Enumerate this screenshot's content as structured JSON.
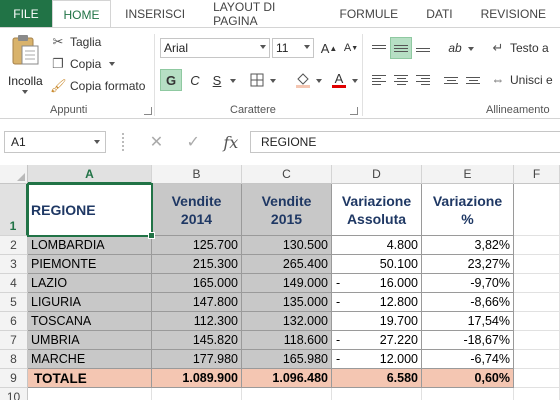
{
  "ribbon_tabs": [
    "FILE",
    "HOME",
    "INSERISCI",
    "LAYOUT DI PAGINA",
    "FORMULE",
    "DATI",
    "REVISIONE"
  ],
  "clipboard": {
    "paste_label": "Incolla",
    "cut_label": "Taglia",
    "copy_label": "Copia",
    "format_painter_label": "Copia formato",
    "group_label": "Appunti"
  },
  "font": {
    "font_name": "Arial",
    "font_size": "11",
    "bold_label": "G",
    "italic_label": "C",
    "underline_label": "S",
    "group_label": "Carattere"
  },
  "alignment": {
    "wrap_text_label": "Testo a",
    "merge_label": "Unisci e",
    "group_label": "Allineamento"
  },
  "formula_bar": {
    "name_box": "A1",
    "cancel_symbol": "✕",
    "enter_symbol": "✓",
    "fx_symbol": "fx",
    "content": "REGIONE"
  },
  "column_headers": [
    "A",
    "B",
    "C",
    "D",
    "E",
    "F"
  ],
  "row_headers": [
    "1",
    "2",
    "3",
    "4",
    "5",
    "6",
    "7",
    "8",
    "9",
    "10"
  ],
  "table": {
    "headers": {
      "a": "REGIONE",
      "b": "Vendite 2014",
      "c": "Vendite 2015",
      "d": "Variazione Assoluta",
      "e": "Variazione %"
    },
    "rows": [
      {
        "region": "LOMBARDIA",
        "v2014": "125.700",
        "v2015": "130.500",
        "neg": "",
        "abs": "4.800",
        "pct": "3,82%"
      },
      {
        "region": "PIEMONTE",
        "v2014": "215.300",
        "v2015": "265.400",
        "neg": "",
        "abs": "50.100",
        "pct": "23,27%"
      },
      {
        "region": "LAZIO",
        "v2014": "165.000",
        "v2015": "149.000",
        "neg": "-",
        "abs": "16.000",
        "pct": "-9,70%"
      },
      {
        "region": "LIGURIA",
        "v2014": "147.800",
        "v2015": "135.000",
        "neg": "-",
        "abs": "12.800",
        "pct": "-8,66%"
      },
      {
        "region": "TOSCANA",
        "v2014": "112.300",
        "v2015": "132.000",
        "neg": "",
        "abs": "19.700",
        "pct": "17,54%"
      },
      {
        "region": "UMBRIA",
        "v2014": "145.820",
        "v2015": "118.600",
        "neg": "-",
        "abs": "27.220",
        "pct": "-18,67%"
      },
      {
        "region": "MARCHE",
        "v2014": "177.980",
        "v2015": "165.980",
        "neg": "-",
        "abs": "12.000",
        "pct": "-6,74%"
      }
    ],
    "total": {
      "label": "TOTALE",
      "v2014": "1.089.900",
      "v2015": "1.096.480",
      "abs": "6.580",
      "pct": "0,60%"
    }
  },
  "colors": {
    "accent": "#217346",
    "data_fill": "#c8c8c8",
    "total_fill": "#f4c6b2",
    "header_text": "#1f3864"
  }
}
